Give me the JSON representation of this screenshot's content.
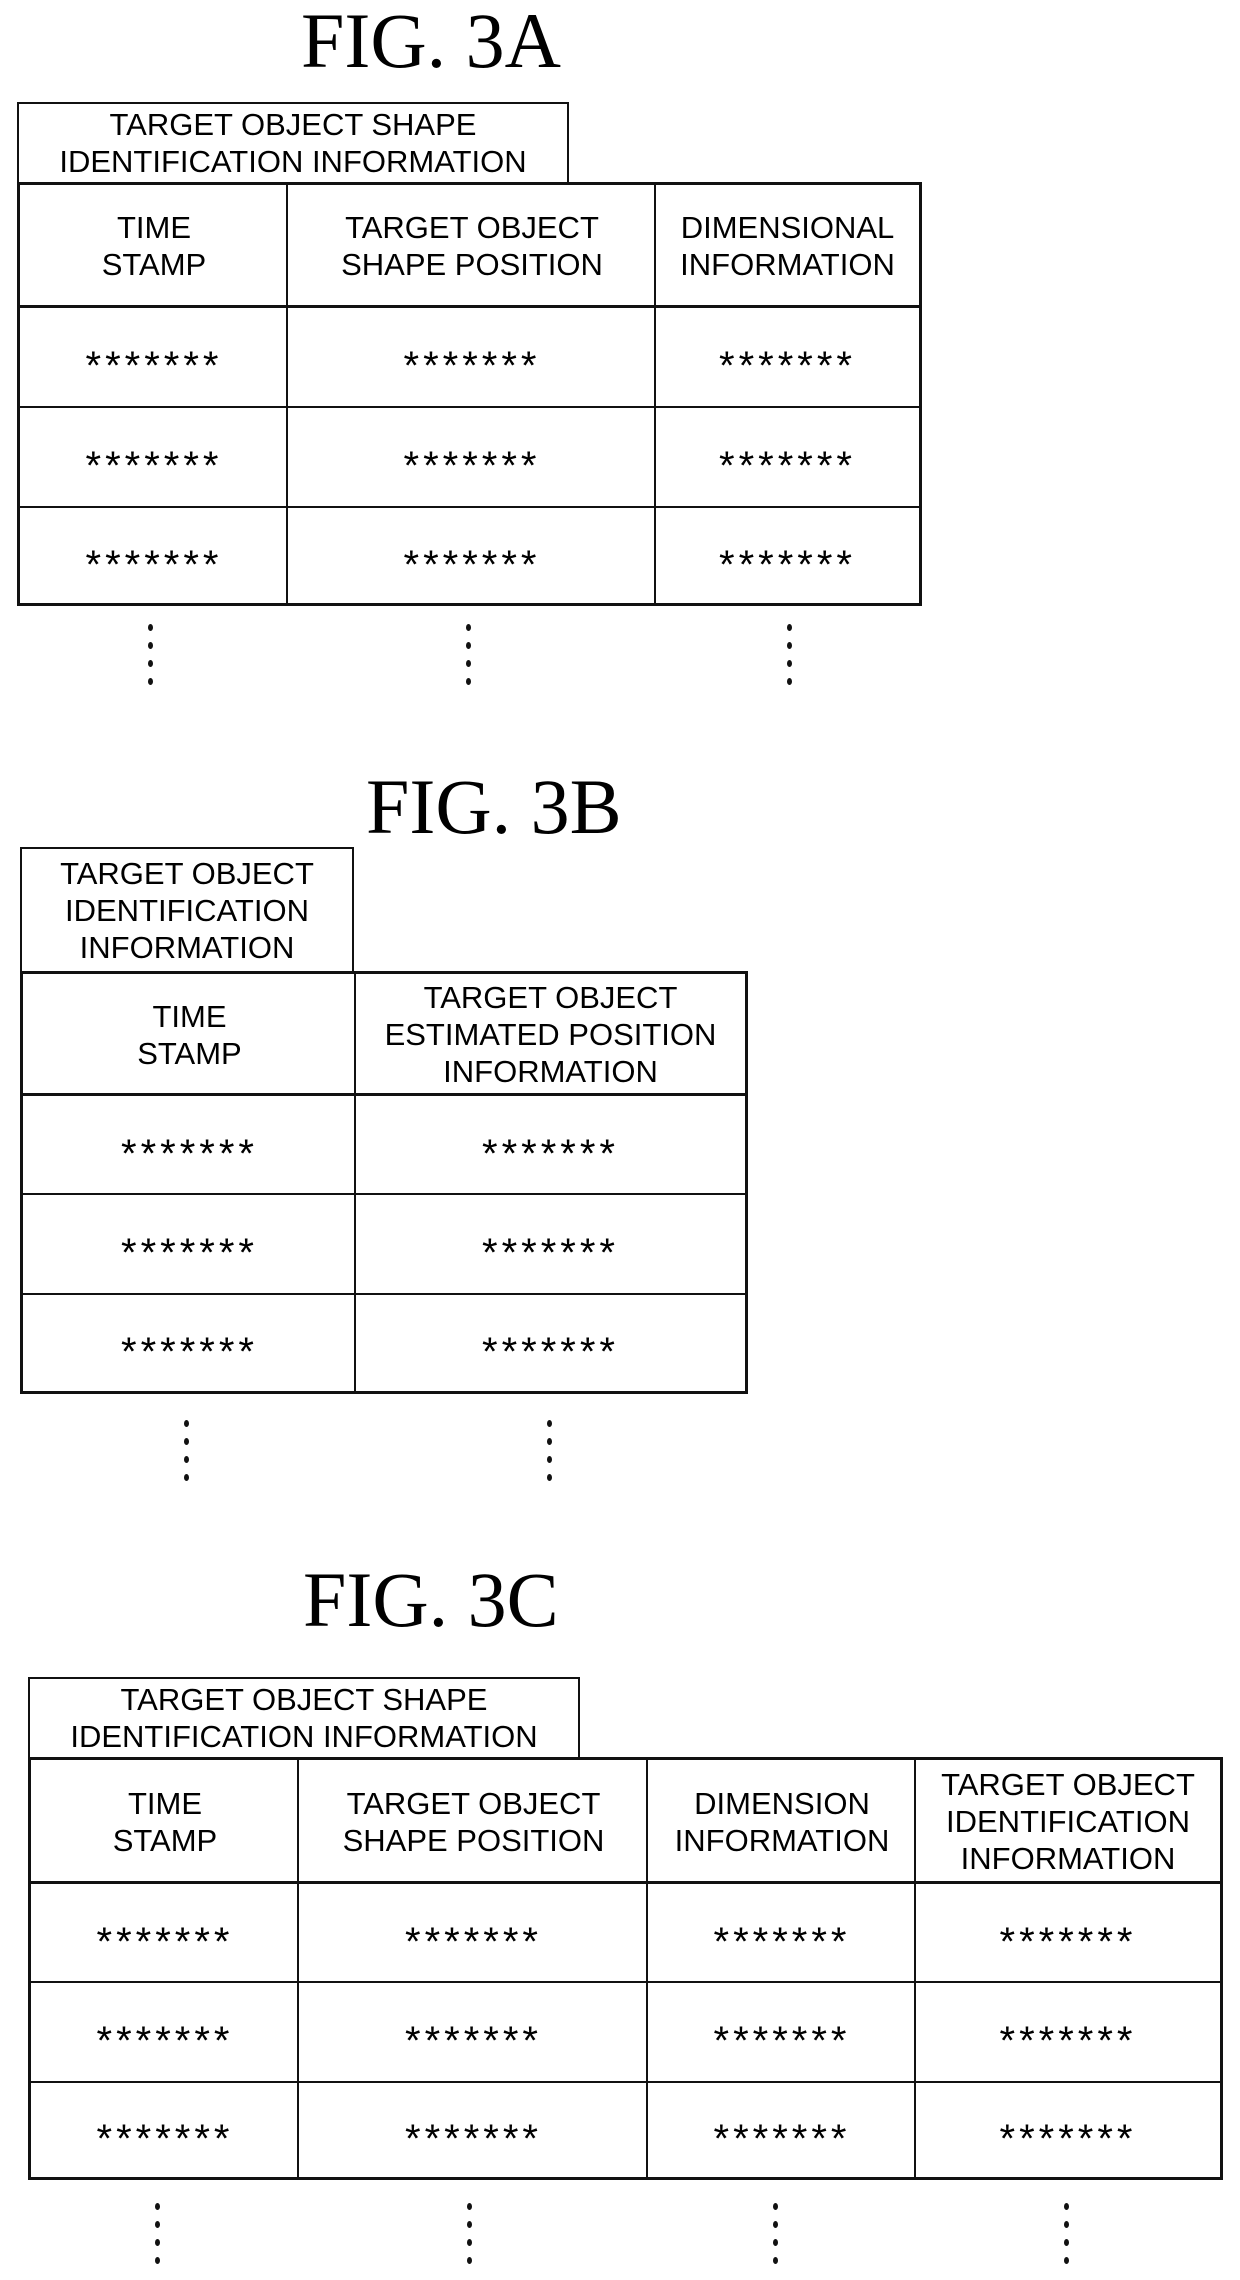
{
  "figures": [
    {
      "id": "3A",
      "title": "FIG. 3A",
      "table_label": "TARGET OBJECT SHAPE\nIDENTIFICATION INFORMATION",
      "columns": [
        "TIME\nSTAMP",
        "TARGET OBJECT\nSHAPE POSITION",
        "DIMENSIONAL\nINFORMATION"
      ],
      "rows": [
        [
          "*******",
          "*******",
          "*******"
        ],
        [
          "*******",
          "*******",
          "*******"
        ],
        [
          "*******",
          "*******",
          "*******"
        ]
      ],
      "continuation": "⋮"
    },
    {
      "id": "3B",
      "title": "FIG. 3B",
      "table_label": "TARGET OBJECT\nIDENTIFICATION\nINFORMATION",
      "columns": [
        "TIME\nSTAMP",
        "TARGET OBJECT\nESTIMATED POSITION\nINFORMATION"
      ],
      "rows": [
        [
          "*******",
          "*******"
        ],
        [
          "*******",
          "*******"
        ],
        [
          "*******",
          "*******"
        ]
      ],
      "continuation": "⋮"
    },
    {
      "id": "3C",
      "title": "FIG. 3C",
      "table_label": "TARGET OBJECT SHAPE\nIDENTIFICATION INFORMATION",
      "columns": [
        "TIME\nSTAMP",
        "TARGET OBJECT\nSHAPE POSITION",
        "DIMENSION\nINFORMATION",
        "TARGET OBJECT\nIDENTIFICATION\nINFORMATION"
      ],
      "rows": [
        [
          "*******",
          "*******",
          "*******",
          "*******"
        ],
        [
          "*******",
          "*******",
          "*******",
          "*******"
        ],
        [
          "*******",
          "*******",
          "*******",
          "*******"
        ]
      ],
      "continuation": "⋮"
    }
  ]
}
